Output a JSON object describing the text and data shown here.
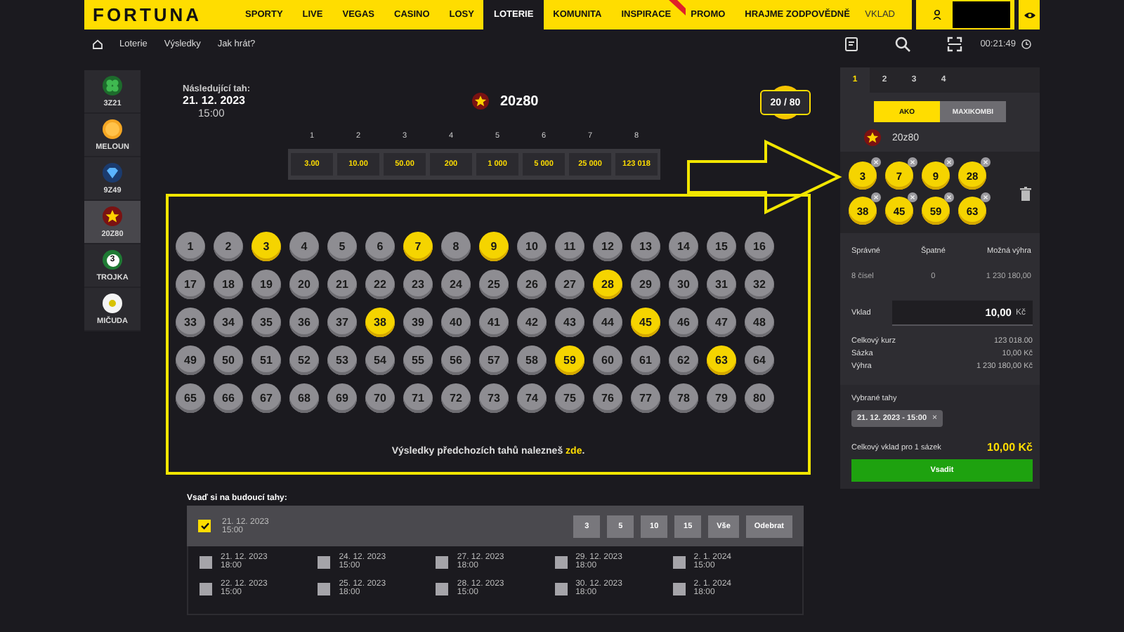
{
  "header": {
    "logo": "FORTUNA",
    "nav": [
      {
        "label": "SPORTY",
        "selected": false,
        "ribbon": false
      },
      {
        "label": "LIVE",
        "selected": false,
        "ribbon": false
      },
      {
        "label": "VEGAS",
        "selected": false,
        "ribbon": false
      },
      {
        "label": "CASINO",
        "selected": false,
        "ribbon": false
      },
      {
        "label": "LOSY",
        "selected": false,
        "ribbon": false
      },
      {
        "label": "LOTERIE",
        "selected": true,
        "ribbon": false
      },
      {
        "label": "KOMUNITA",
        "selected": false,
        "ribbon": false
      },
      {
        "label": "INSPIRACE",
        "selected": false,
        "ribbon": true
      },
      {
        "label": "PROMO",
        "selected": false,
        "ribbon": false
      },
      {
        "label": "HRAJME ZODPOVĚDNĚ",
        "selected": false,
        "ribbon": false
      }
    ],
    "deposit": "VKLAD"
  },
  "subnav": {
    "links": [
      "Loterie",
      "Výsledky",
      "Jak hrát?"
    ],
    "clock": "00:21:49"
  },
  "sidebar": {
    "items": [
      {
        "label": "3Z21",
        "kind": "clover",
        "selected": false
      },
      {
        "label": "MELOUN",
        "kind": "melon",
        "selected": false
      },
      {
        "label": "9Z49",
        "kind": "diamond",
        "selected": false
      },
      {
        "label": "20Z80",
        "kind": "star",
        "selected": true
      },
      {
        "label": "TROJKA",
        "kind": "digit",
        "mark": "3",
        "selected": false
      },
      {
        "label": "MIČUDA",
        "kind": "ball",
        "selected": false
      }
    ]
  },
  "draw": {
    "next_label": "Následující tah:",
    "next_date": "21. 12. 2023",
    "next_time": "15:00",
    "game": "20z80",
    "counter": "20 / 80"
  },
  "payouts": {
    "hits": [
      "1",
      "2",
      "3",
      "4",
      "5",
      "6",
      "7",
      "8"
    ],
    "odds": [
      "3.00",
      "10.00",
      "50.00",
      "200",
      "1 000",
      "5 000",
      "25 000",
      "123 018"
    ]
  },
  "numbers": [
    {
      "label": "1",
      "selected": false
    },
    {
      "label": "2",
      "selected": false
    },
    {
      "label": "3",
      "selected": true
    },
    {
      "label": "4",
      "selected": false
    },
    {
      "label": "5",
      "selected": false
    },
    {
      "label": "6",
      "selected": false
    },
    {
      "label": "7",
      "selected": true
    },
    {
      "label": "8",
      "selected": false
    },
    {
      "label": "9",
      "selected": true
    },
    {
      "label": "10",
      "selected": false
    },
    {
      "label": "11",
      "selected": false
    },
    {
      "label": "12",
      "selected": false
    },
    {
      "label": "13",
      "selected": false
    },
    {
      "label": "14",
      "selected": false
    },
    {
      "label": "15",
      "selected": false
    },
    {
      "label": "16",
      "selected": false
    },
    {
      "label": "17",
      "selected": false
    },
    {
      "label": "18",
      "selected": false
    },
    {
      "label": "19",
      "selected": false
    },
    {
      "label": "20",
      "selected": false
    },
    {
      "label": "21",
      "selected": false
    },
    {
      "label": "22",
      "selected": false
    },
    {
      "label": "23",
      "selected": false
    },
    {
      "label": "24",
      "selected": false
    },
    {
      "label": "25",
      "selected": false
    },
    {
      "label": "26",
      "selected": false
    },
    {
      "label": "27",
      "selected": false
    },
    {
      "label": "28",
      "selected": true
    },
    {
      "label": "29",
      "selected": false
    },
    {
      "label": "30",
      "selected": false
    },
    {
      "label": "31",
      "selected": false
    },
    {
      "label": "32",
      "selected": false
    },
    {
      "label": "33",
      "selected": false
    },
    {
      "label": "34",
      "selected": false
    },
    {
      "label": "35",
      "selected": false
    },
    {
      "label": "36",
      "selected": false
    },
    {
      "label": "37",
      "selected": false
    },
    {
      "label": "38",
      "selected": true
    },
    {
      "label": "39",
      "selected": false
    },
    {
      "label": "40",
      "selected": false
    },
    {
      "label": "41",
      "selected": false
    },
    {
      "label": "42",
      "selected": false
    },
    {
      "label": "43",
      "selected": false
    },
    {
      "label": "44",
      "selected": false
    },
    {
      "label": "45",
      "selected": true
    },
    {
      "label": "46",
      "selected": false
    },
    {
      "label": "47",
      "selected": false
    },
    {
      "label": "48",
      "selected": false
    },
    {
      "label": "49",
      "selected": false
    },
    {
      "label": "50",
      "selected": false
    },
    {
      "label": "51",
      "selected": false
    },
    {
      "label": "52",
      "selected": false
    },
    {
      "label": "53",
      "selected": false
    },
    {
      "label": "54",
      "selected": false
    },
    {
      "label": "55",
      "selected": false
    },
    {
      "label": "56",
      "selected": false
    },
    {
      "label": "57",
      "selected": false
    },
    {
      "label": "58",
      "selected": false
    },
    {
      "label": "59",
      "selected": true
    },
    {
      "label": "60",
      "selected": false
    },
    {
      "label": "61",
      "selected": false
    },
    {
      "label": "62",
      "selected": false
    },
    {
      "label": "63",
      "selected": true
    },
    {
      "label": "64",
      "selected": false
    },
    {
      "label": "65",
      "selected": false
    },
    {
      "label": "66",
      "selected": false
    },
    {
      "label": "67",
      "selected": false
    },
    {
      "label": "68",
      "selected": false
    },
    {
      "label": "69",
      "selected": false
    },
    {
      "label": "70",
      "selected": false
    },
    {
      "label": "71",
      "selected": false
    },
    {
      "label": "72",
      "selected": false
    },
    {
      "label": "73",
      "selected": false
    },
    {
      "label": "74",
      "selected": false
    },
    {
      "label": "75",
      "selected": false
    },
    {
      "label": "76",
      "selected": false
    },
    {
      "label": "77",
      "selected": false
    },
    {
      "label": "78",
      "selected": false
    },
    {
      "label": "79",
      "selected": false
    },
    {
      "label": "80",
      "selected": false
    }
  ],
  "results_note": {
    "text": "Výsledky předchozích tahů nalezneš",
    "link": "zde",
    "suffix": "."
  },
  "future": {
    "title": "Vsaď si na budoucí tahy:",
    "current": {
      "date": "21. 12. 2023",
      "time": "15:00",
      "checked": true
    },
    "quick": [
      "3",
      "5",
      "10",
      "15",
      "Vše"
    ],
    "remove": "Odebrat",
    "draws": [
      {
        "date": "21. 12. 2023",
        "time": "18:00",
        "checked": false
      },
      {
        "date": "24. 12. 2023",
        "time": "15:00",
        "checked": false
      },
      {
        "date": "27. 12. 2023",
        "time": "18:00",
        "checked": false
      },
      {
        "date": "29. 12. 2023",
        "time": "18:00",
        "checked": false
      },
      {
        "date": "2. 1. 2024",
        "time": "15:00",
        "checked": false
      },
      {
        "date": "22. 12. 2023",
        "time": "15:00",
        "checked": false
      },
      {
        "date": "25. 12. 2023",
        "time": "18:00",
        "checked": false
      },
      {
        "date": "28. 12. 2023",
        "time": "15:00",
        "checked": false
      },
      {
        "date": "30. 12. 2023",
        "time": "18:00",
        "checked": false
      },
      {
        "date": "2. 1. 2024",
        "time": "18:00",
        "checked": false
      }
    ]
  },
  "ticket": {
    "tabs": [
      {
        "label": "1",
        "selected": true
      },
      {
        "label": "2",
        "selected": false
      },
      {
        "label": "3",
        "selected": false
      },
      {
        "label": "4",
        "selected": false
      }
    ],
    "modes": [
      {
        "label": "AKO",
        "selected": true
      },
      {
        "label": "MAXIKOMBI",
        "selected": false
      }
    ],
    "game": "20z80",
    "picks": [
      "3",
      "7",
      "9",
      "28",
      "38",
      "45",
      "59",
      "63"
    ],
    "columns": [
      "Správné",
      "Špatné",
      "Možná výhra"
    ],
    "row": [
      "8 čísel",
      "0",
      "1 230 180,00"
    ],
    "stake_label": "Vklad",
    "stake_value": "10,00",
    "currency": "Kč",
    "summary": [
      {
        "label": "Celkový kurz",
        "value": "123 018.00"
      },
      {
        "label": "Sázka",
        "value": "10,00 Kč"
      },
      {
        "label": "Výhra",
        "value": "1 230 180,00 Kč"
      }
    ],
    "draws_label": "Vybrané tahy",
    "chip": "21. 12. 2023 - 15:00",
    "chip_close": "×",
    "total_label": "Celkový vklad pro 1 sázek",
    "total": "10,00 Kč",
    "submit": "Vsadit"
  }
}
